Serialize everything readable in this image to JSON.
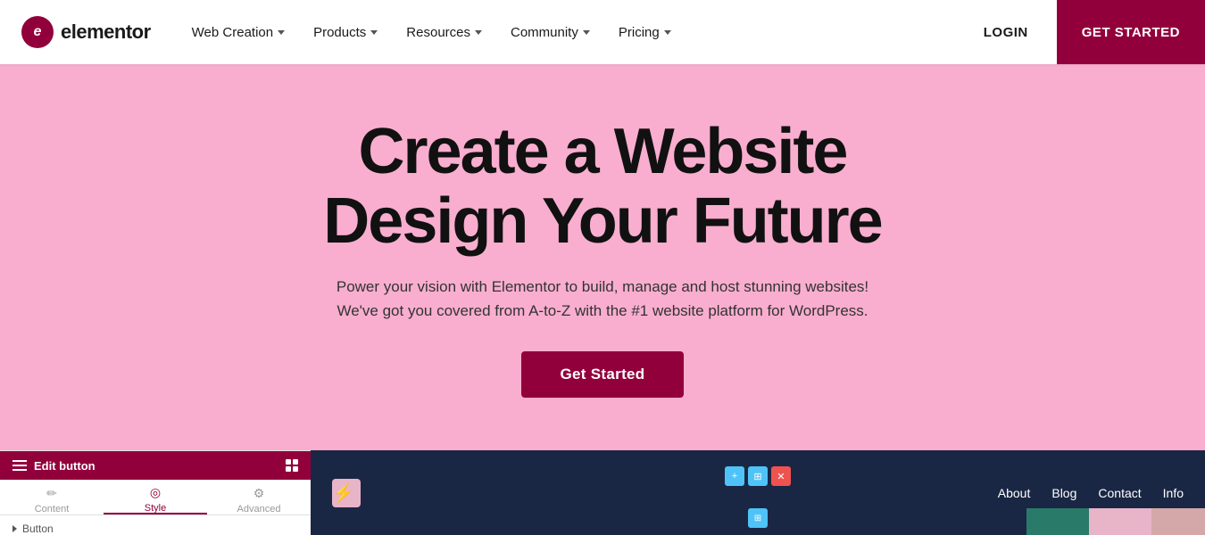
{
  "brand": {
    "logo_letter": "e",
    "logo_name": "elementor"
  },
  "navbar": {
    "items": [
      {
        "label": "Web Creation",
        "has_dropdown": true
      },
      {
        "label": "Products",
        "has_dropdown": true
      },
      {
        "label": "Resources",
        "has_dropdown": true
      },
      {
        "label": "Community",
        "has_dropdown": true
      },
      {
        "label": "Pricing",
        "has_dropdown": true
      }
    ],
    "login_label": "LOGIN",
    "get_started_label": "GET STARTED"
  },
  "hero": {
    "title_line1": "Create a Website",
    "title_line2": "Design Your Future",
    "subtitle_line1": "Power your vision with Elementor to build, manage and host stunning websites!",
    "subtitle_line2": "We've got you covered from A-to-Z with the #1 website platform for WordPress.",
    "cta_label": "Get Started"
  },
  "editor_panel": {
    "header_label": "Edit button",
    "tabs": [
      {
        "label": "Content",
        "active": false
      },
      {
        "label": "Style",
        "active": true
      },
      {
        "label": "Advanced",
        "active": false
      }
    ],
    "section_label": "Button"
  },
  "site_preview": {
    "nav_links": [
      "About",
      "Blog",
      "Contact",
      "Info"
    ]
  },
  "colors": {
    "brand_red": "#92003B",
    "hero_bg": "#F9AECF",
    "navbar_bg": "#ffffff",
    "preview_bg": "#1a2744"
  }
}
